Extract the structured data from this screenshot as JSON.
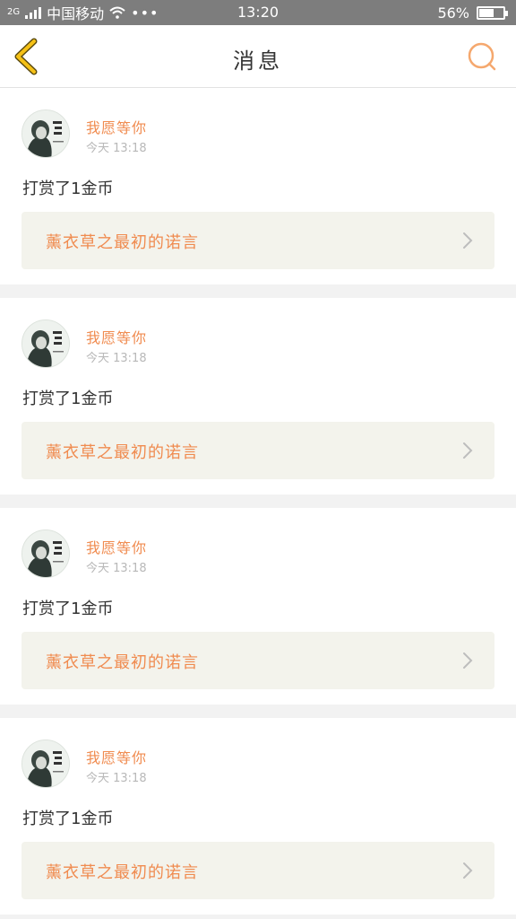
{
  "status_bar": {
    "signal_label": "2G",
    "carrier": "中国移动",
    "dots": "•••",
    "time": "13:20",
    "battery_text": "56%",
    "battery_level": 0.56
  },
  "nav": {
    "title": "消息",
    "back_icon": "chevron-left-icon",
    "search_icon": "search-icon"
  },
  "colors": {
    "accent": "#f08b4f",
    "back": "#f5c116"
  },
  "messages": [
    {
      "user": "我愿等你",
      "time": "今天 13:18",
      "text": "打赏了1金币",
      "post_title": "薰衣草之最初的诺言"
    },
    {
      "user": "我愿等你",
      "time": "今天 13:18",
      "text": "打赏了1金币",
      "post_title": "薰衣草之最初的诺言"
    },
    {
      "user": "我愿等你",
      "time": "今天 13:18",
      "text": "打赏了1金币",
      "post_title": "薰衣草之最初的诺言"
    },
    {
      "user": "我愿等你",
      "time": "今天 13:18",
      "text": "打赏了1金币",
      "post_title": "薰衣草之最初的诺言"
    }
  ]
}
